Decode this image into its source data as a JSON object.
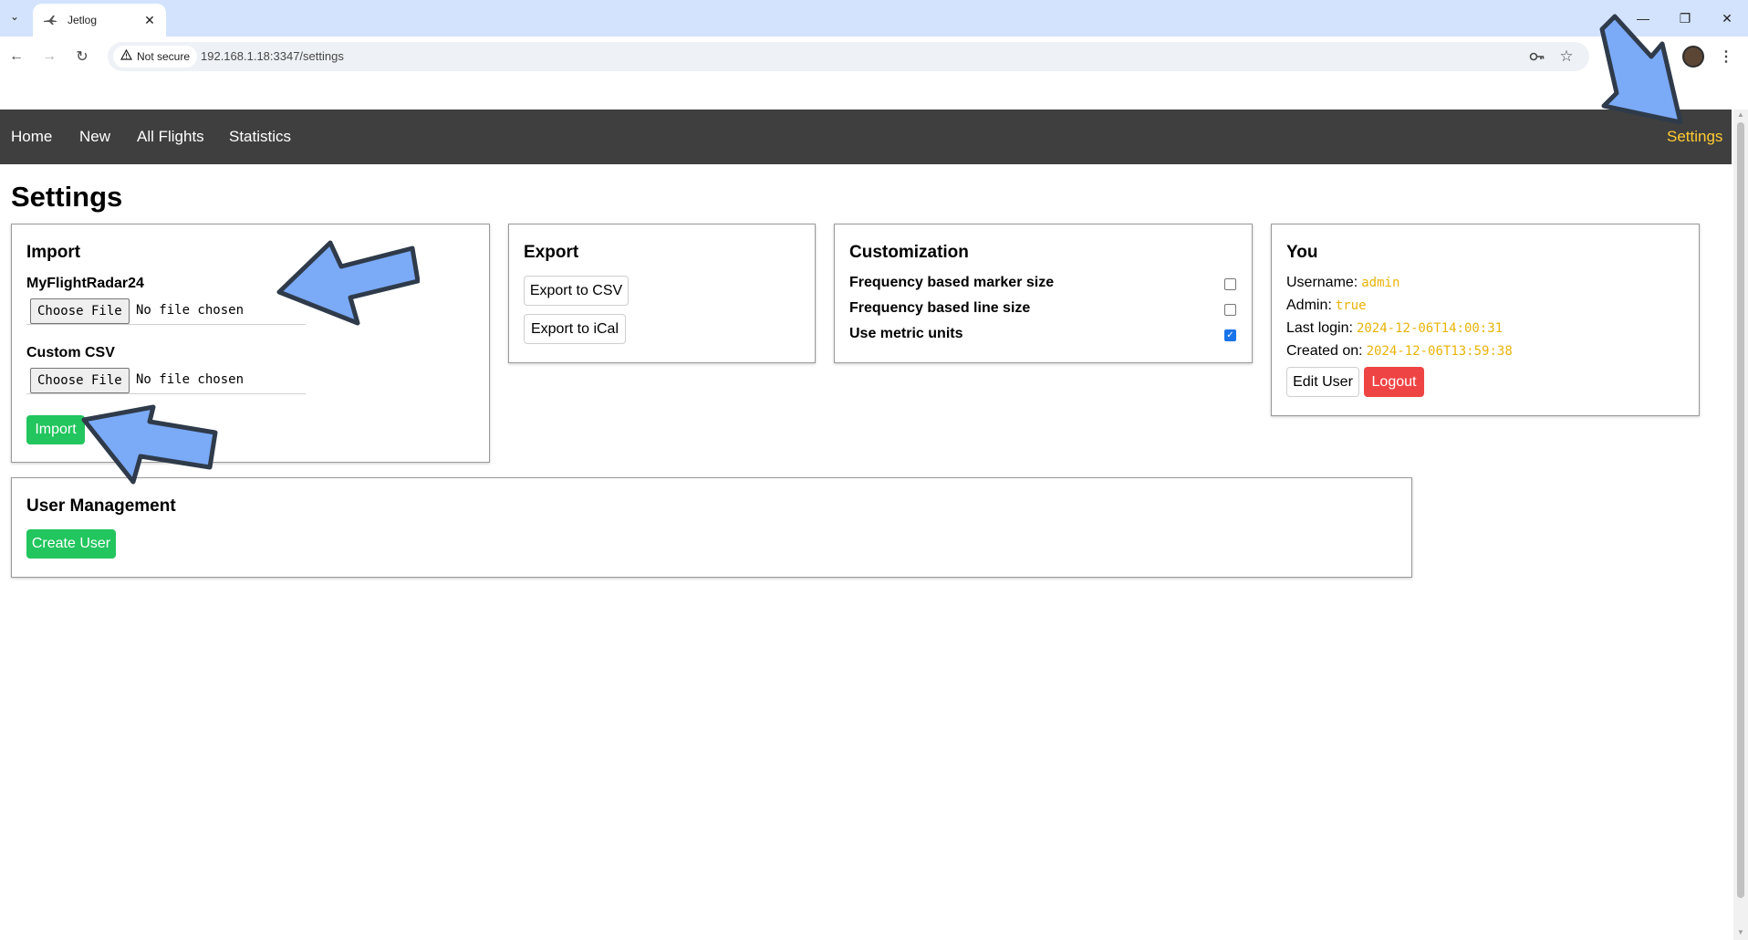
{
  "browser": {
    "tab_title": "Jetlog",
    "security_label": "Not secure",
    "url": "192.168.1.18:3347/settings"
  },
  "nav": {
    "home": "Home",
    "new": "New",
    "all_flights": "All Flights",
    "statistics": "Statistics",
    "settings": "Settings"
  },
  "page": {
    "title": "Settings"
  },
  "import": {
    "heading": "Import",
    "fr24_label": "MyFlightRadar24",
    "csv_label": "Custom CSV",
    "choose_file": "Choose File",
    "no_file": "No file chosen",
    "import_button": "Import"
  },
  "export": {
    "heading": "Export",
    "csv_button": "Export to CSV",
    "ical_button": "Export to iCal"
  },
  "customization": {
    "heading": "Customization",
    "options": [
      {
        "label": "Frequency based marker size",
        "checked": false
      },
      {
        "label": "Frequency based line size",
        "checked": false
      },
      {
        "label": "Use metric units",
        "checked": true
      }
    ]
  },
  "you": {
    "heading": "You",
    "username_label": "Username:",
    "username_value": "admin",
    "admin_label": "Admin:",
    "admin_value": "true",
    "last_login_label": "Last login:",
    "last_login_value": "2024-12-06T14:00:31",
    "created_label": "Created on:",
    "created_value": "2024-12-06T13:59:38",
    "edit_button": "Edit User",
    "logout_button": "Logout"
  },
  "user_management": {
    "heading": "User Management",
    "create_button": "Create User"
  },
  "colors": {
    "nav_bg": "#3f3f3f",
    "nav_active": "#ffcc33",
    "green": "#22c55e",
    "red": "#ef4444",
    "mono_value": "#eab308",
    "annotation_arrow": "#7baaf7"
  }
}
